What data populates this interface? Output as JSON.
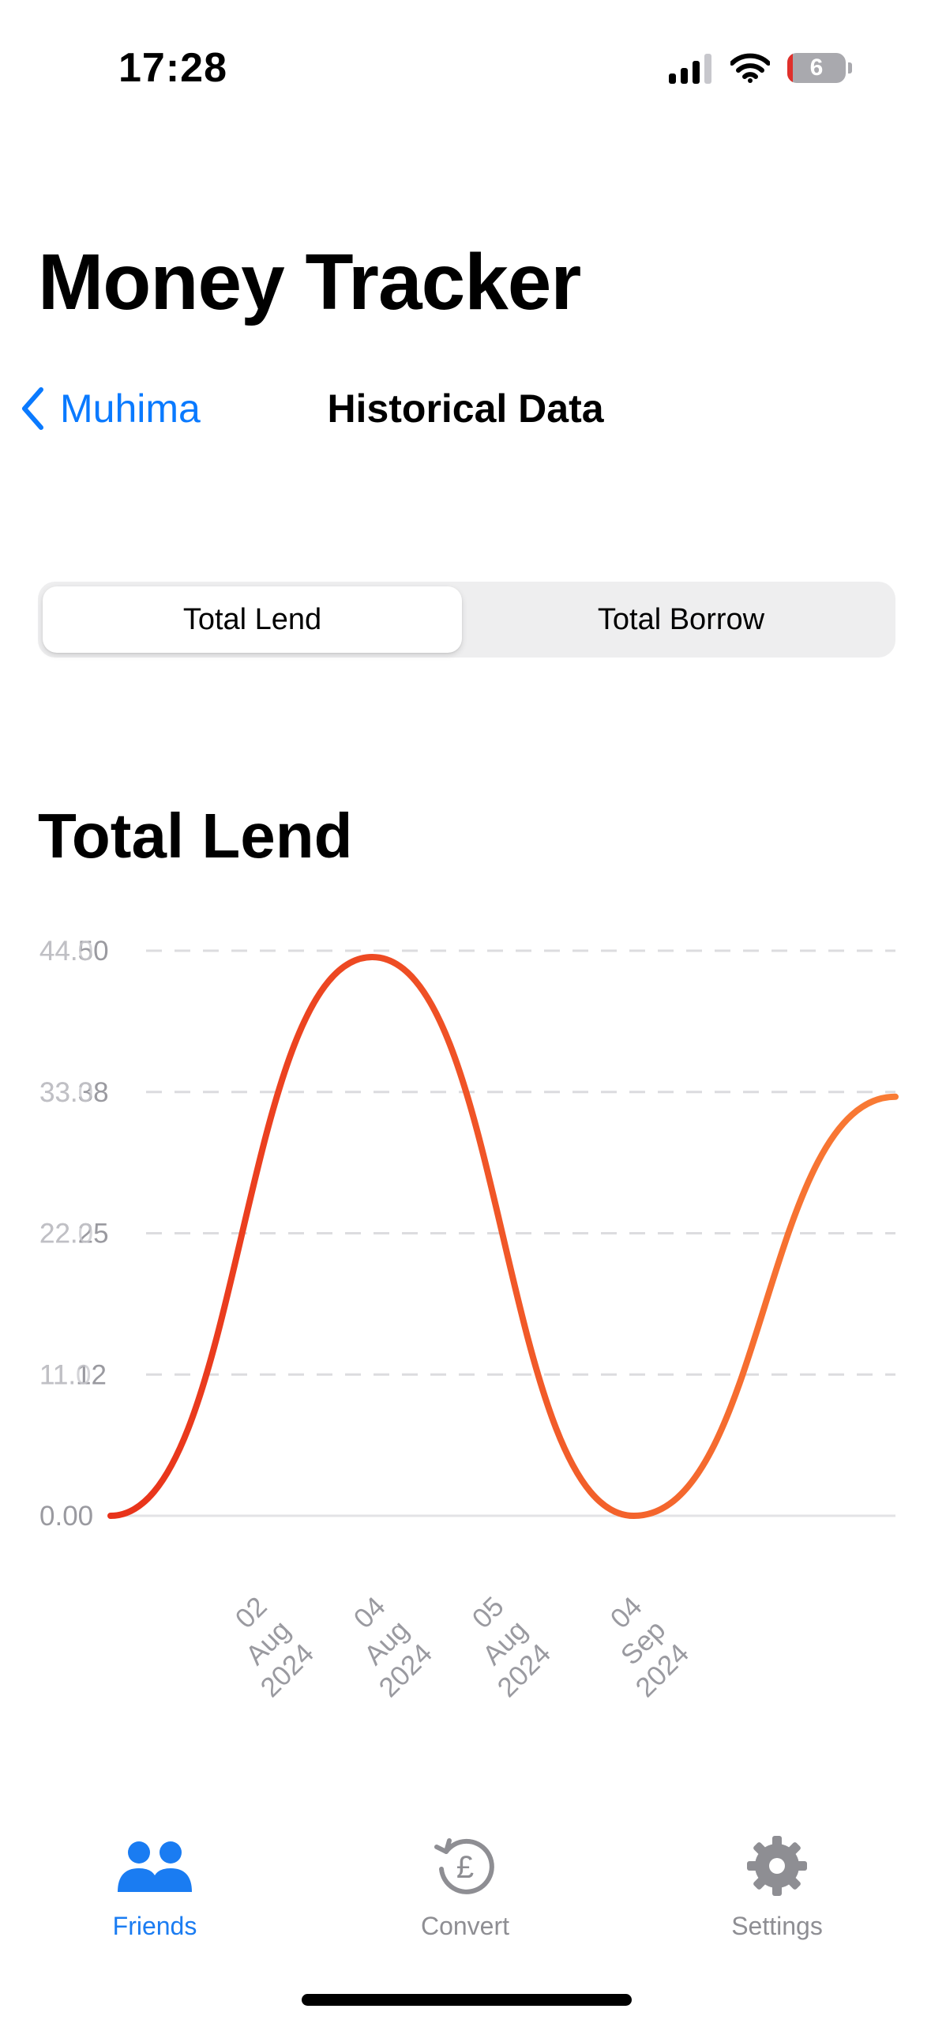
{
  "status_bar": {
    "time": "17:28",
    "battery": "6"
  },
  "header": {
    "app_title": "Money Tracker",
    "back_label": "Muhima",
    "nav_title": "Historical Data"
  },
  "segmented_control": {
    "options": [
      "Total Lend",
      "Total Borrow"
    ],
    "selected_index": 0
  },
  "chart_title": "Total Lend",
  "chart_data": {
    "type": "line",
    "interpolation": "smooth",
    "title": "Total Lend",
    "x": [
      "02 Aug 2024",
      "04 Aug 2024",
      "05 Aug 2024",
      "04 Sep 2024"
    ],
    "values": [
      0,
      44,
      0,
      33
    ],
    "y_ticks_primary": [
      "0.00",
      "11.12",
      "22.25",
      "33.38",
      "44.50"
    ],
    "y_ticks_overlap": [
      "0.00",
      "11.0",
      "22.0",
      "33.0",
      "44.0"
    ],
    "ylim": [
      0,
      44.5
    ],
    "grid": true,
    "line_colors": [
      "#e8321a",
      "#f97c35"
    ]
  },
  "tab_bar": {
    "items": [
      {
        "label": "Friends",
        "icon": "people-icon",
        "active": true
      },
      {
        "label": "Convert",
        "icon": "currency-pound-arrow-icon",
        "active": false
      },
      {
        "label": "Settings",
        "icon": "gear-icon",
        "active": false
      }
    ],
    "active_color": "#1a7cf2",
    "inactive_color": "#8e8e93"
  }
}
